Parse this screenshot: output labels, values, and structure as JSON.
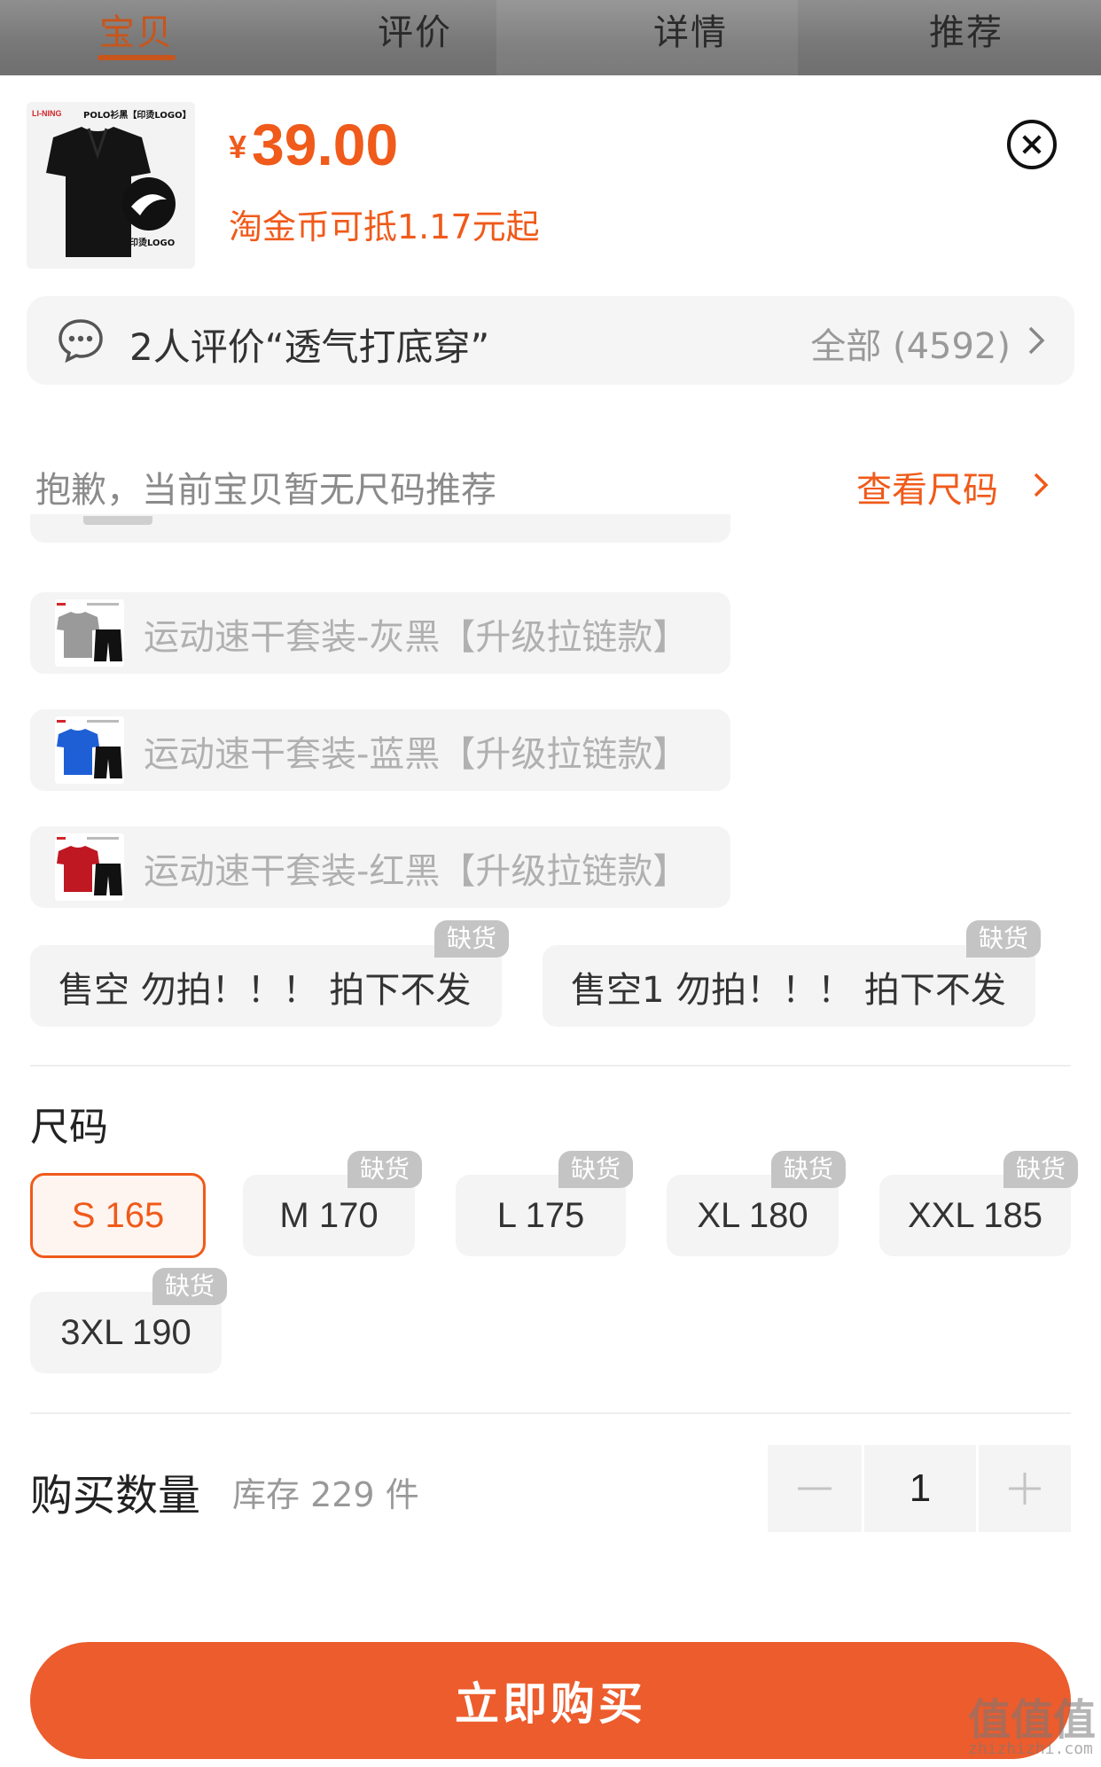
{
  "tabs": [
    "宝贝",
    "评价",
    "详情",
    "推荐"
  ],
  "product": {
    "thumb_caption": "POLO衫黑【印烫LOGO】",
    "thumb_logo_caption": "印烫LOGO",
    "currency": "¥",
    "price": "39.00",
    "coupon_text": "淘金币可抵1.17元起"
  },
  "review": {
    "summary": "2人评价“透气打底穿”",
    "all_label": "全部 (4592)"
  },
  "size_recommendation": {
    "message": "抱歉，当前宝贝暂无尺码推荐",
    "link_label": "查看尺码"
  },
  "color_options": [
    {
      "label": "运动速干套装-灰黑【升级拉链款】",
      "shirt_color": "#9a9a9a"
    },
    {
      "label": "运动速干套装-蓝黑【升级拉链款】",
      "shirt_color": "#1f5fd6"
    },
    {
      "label": "运动速干套装-红黑【升级拉链款】",
      "shirt_color": "#c01822"
    }
  ],
  "sold_out_options": [
    {
      "label": "售空 勿拍！！！ 拍下不发",
      "badge": "缺货"
    },
    {
      "label": "售空1 勿拍！！！ 拍下不发",
      "badge": "缺货"
    }
  ],
  "size_section": {
    "title": "尺码",
    "sizes": [
      {
        "label": "S 165",
        "selected": true,
        "badge": ""
      },
      {
        "label": "M 170",
        "selected": false,
        "badge": "缺货"
      },
      {
        "label": "L 175",
        "selected": false,
        "badge": "缺货"
      },
      {
        "label": "XL 180",
        "selected": false,
        "badge": "缺货"
      },
      {
        "label": "XXL 185",
        "selected": false,
        "badge": "缺货"
      },
      {
        "label": "3XL 190",
        "selected": false,
        "badge": "缺货"
      }
    ]
  },
  "quantity": {
    "label": "购买数量",
    "stock": "库存 229 件",
    "value": "1"
  },
  "buy_button": "立即购买",
  "watermark": {
    "main": "值值值",
    "sub": "zhizhizhi.com"
  },
  "colors": {
    "accent": "#f05a1a",
    "buy": "#ec5c2d",
    "badge": "#c4c4c4"
  }
}
